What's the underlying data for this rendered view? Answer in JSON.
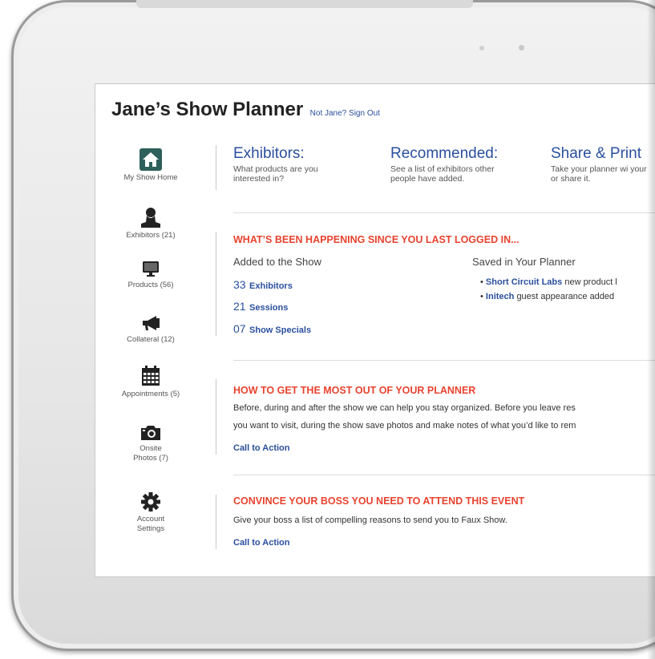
{
  "header": {
    "title": "Jane’s Show Planner",
    "signout_link": "Not Jane? Sign Out"
  },
  "sidebar": {
    "items": [
      {
        "label": "My Show Home",
        "icon": "home-icon"
      },
      {
        "label": "Exhibitors (21)",
        "icon": "person-icon"
      },
      {
        "label": "Products (56)",
        "icon": "monitor-icon"
      },
      {
        "label": "Collateral (12)",
        "icon": "megaphone-icon"
      },
      {
        "label": "Appointments (5)",
        "icon": "calendar-icon"
      },
      {
        "label_line1": "Onsite",
        "label_line2": "Photos (7)",
        "icon": "camera-icon"
      },
      {
        "label_line1": "Account",
        "label_line2": "Settings",
        "icon": "gear-icon"
      }
    ]
  },
  "cards": [
    {
      "title": "Exhibitors:",
      "desc": "What products are you interested in?"
    },
    {
      "title": "Recommended:",
      "desc": "See a list of exhibitors other people have added."
    },
    {
      "title": "Share & Print",
      "desc": "Take your planner wi your or share it."
    }
  ],
  "happening": {
    "heading": "WHAT’S BEEN HAPPENING SINCE YOU LAST LOGGED IN...",
    "added_heading": "Added to the Show",
    "saved_heading": "Saved in Your Planner",
    "stats": [
      {
        "num": "33",
        "label": "Exhibitors"
      },
      {
        "num": "21",
        "label": "Sessions"
      },
      {
        "num": "07",
        "label": "Show Specials"
      }
    ],
    "saved": [
      {
        "name": "Short Circuit Labs",
        "text": "new product l"
      },
      {
        "name": "Initech",
        "text": "guest appearance added"
      }
    ]
  },
  "howto": {
    "heading": "HOW TO GET THE MOST OUT OF YOUR PLANNER",
    "line1": "Before, during and after the show we can help you stay organized. Before you leave res",
    "line2": "you want to visit, during the show save photos and make notes of what you’d like to rem",
    "cta": "Call to Action"
  },
  "convince": {
    "heading": "CONVINCE YOUR BOSS YOU NEED TO ATTEND THIS EVENT",
    "line1": "Give your boss a list of compelling reasons to send you to Faux Show.",
    "cta": "Call to Action"
  },
  "colors": {
    "accent_blue": "#2a4f9e",
    "heading_red": "#e8432f",
    "home_icon_bg": "#2f5f5b"
  }
}
